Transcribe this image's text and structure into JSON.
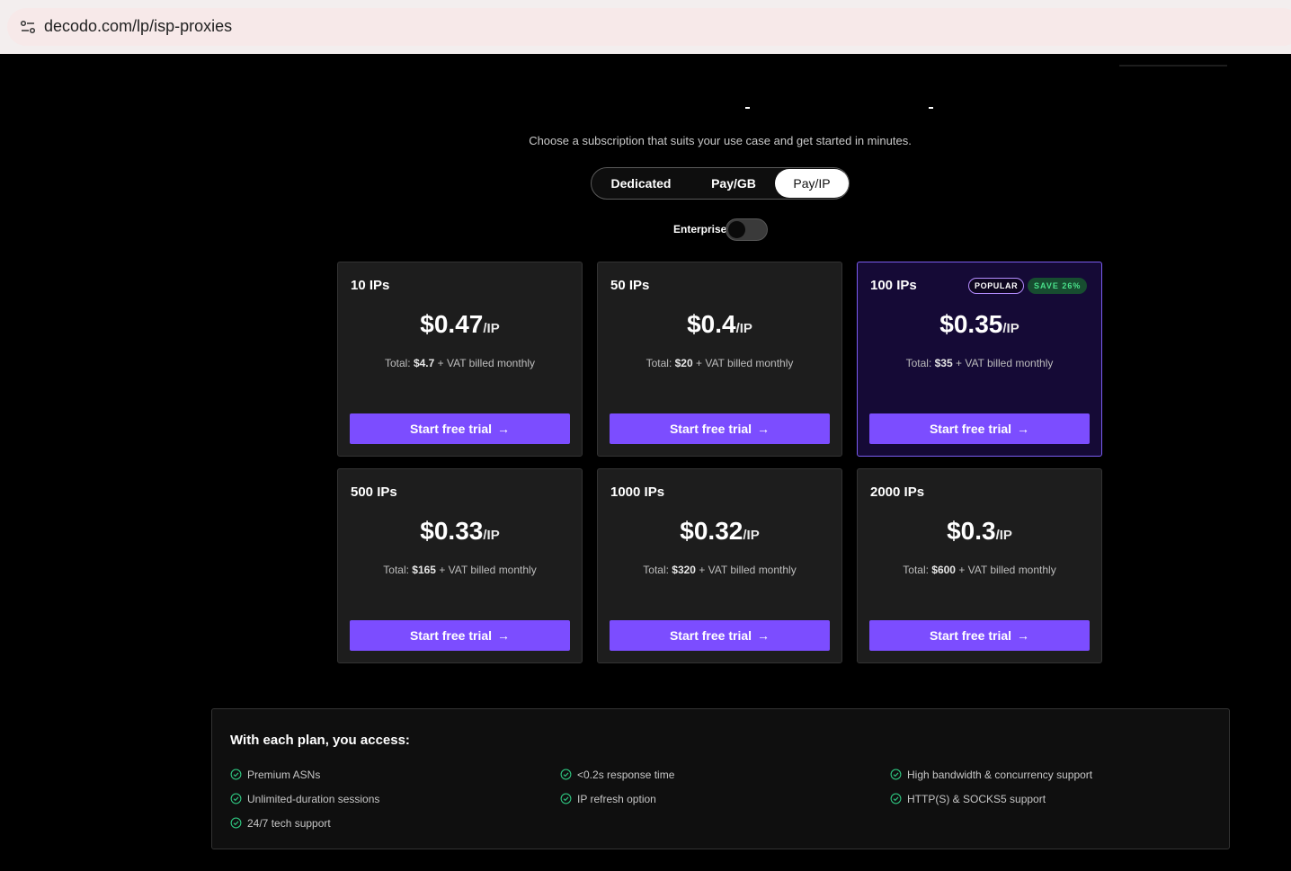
{
  "browser": {
    "url": "decodo.com/lp/isp-proxies",
    "icon": "site-info-icon"
  },
  "header": {
    "subtitle": "Choose a subscription that suits your use case and get started in minutes."
  },
  "tabs": [
    {
      "label": "Dedicated",
      "active": false
    },
    {
      "label": "Pay/GB",
      "active": false
    },
    {
      "label": "Pay/IP",
      "active": true
    }
  ],
  "enterprise": {
    "label": "Enterprise",
    "enabled": false
  },
  "plans": [
    {
      "title": "10 IPs",
      "price": "$0.47",
      "unit": "/IP",
      "total_prefix": "Total: ",
      "total": "$4.7",
      "total_suffix": " + VAT billed monthly",
      "cta": "Start free trial"
    },
    {
      "title": "50 IPs",
      "price": "$0.4",
      "unit": "/IP",
      "total_prefix": "Total: ",
      "total": "$20",
      "total_suffix": " + VAT billed monthly",
      "cta": "Start free trial"
    },
    {
      "title": "100 IPs",
      "price": "$0.35",
      "unit": "/IP",
      "total_prefix": "Total: ",
      "total": "$35",
      "total_suffix": " + VAT billed monthly",
      "cta": "Start free trial",
      "badge_popular": "POPULAR",
      "badge_save": "SAVE 26%"
    },
    {
      "title": "500 IPs",
      "price": "$0.33",
      "unit": "/IP",
      "total_prefix": "Total: ",
      "total": "$165",
      "total_suffix": " + VAT billed monthly",
      "cta": "Start free trial"
    },
    {
      "title": "1000 IPs",
      "price": "$0.32",
      "unit": "/IP",
      "total_prefix": "Total: ",
      "total": "$320",
      "total_suffix": " + VAT billed monthly",
      "cta": "Start free trial"
    },
    {
      "title": "2000 IPs",
      "price": "$0.3",
      "unit": "/IP",
      "total_prefix": "Total: ",
      "total": "$600",
      "total_suffix": " + VAT billed monthly",
      "cta": "Start free trial"
    }
  ],
  "features": {
    "title": "With each plan, you access:",
    "items": [
      "Premium ASNs",
      "<0.2s response time",
      "High bandwidth & concurrency support",
      "Unlimited-duration sessions",
      "IP refresh option",
      "HTTP(S) & SOCKS5 support",
      "24/7 tech support"
    ]
  },
  "colors": {
    "accent": "#7c4dff",
    "featured_bg": "#150a36",
    "save_green": "#49e08a"
  }
}
